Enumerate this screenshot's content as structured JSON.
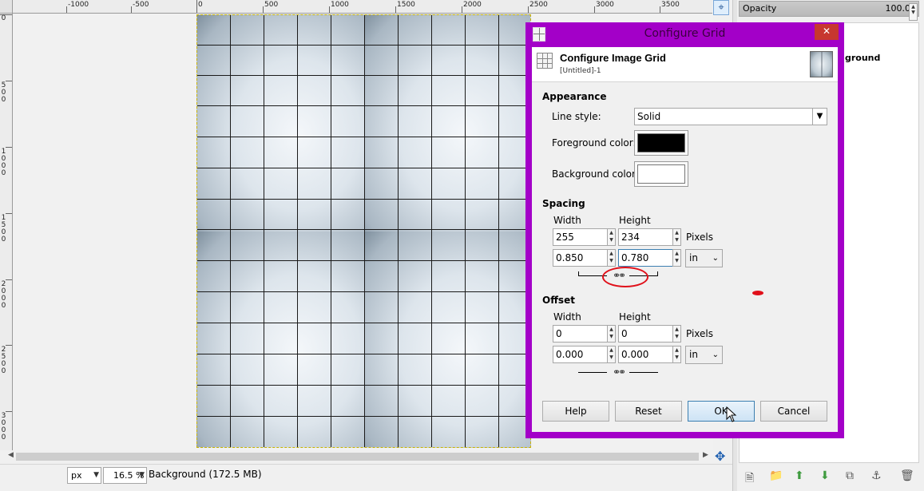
{
  "ruler_top": {
    "labels": [
      "-1000",
      "-500",
      "0",
      "500",
      "1000",
      "1500",
      "2000",
      "2500",
      "3000",
      "3500"
    ]
  },
  "ruler_left": {
    "labels": [
      "0",
      "5\n0\n0",
      "1\n0\n0\n0",
      "1\n5\n0\n0",
      "2\n0\n0\n0",
      "2\n5\n0\n0",
      "3\n0\n0\n0"
    ]
  },
  "statusbar": {
    "unit": "px",
    "zoom": "16.5 %",
    "status_text": "Background (172.5 MB)"
  },
  "dock": {
    "opacity_label": "Opacity",
    "opacity_value": "100.0",
    "layer_name_partial": "ground"
  },
  "dialog": {
    "window_title": "Configure Grid",
    "heading": "Configure Image Grid",
    "subheading": "[Untitled]-1",
    "appearance": {
      "title": "Appearance",
      "line_style_label": "Line style:",
      "line_style_value": "Solid",
      "foreground_label": "Foreground color:",
      "foreground_color": "#000000",
      "background_label": "Background color:",
      "background_color": "#ffffff"
    },
    "spacing": {
      "title": "Spacing",
      "width_label": "Width",
      "height_label": "Height",
      "width_px": "255",
      "height_px": "234",
      "px_unit": "Pixels",
      "width_in": "0.850",
      "height_in": "0.780",
      "unit": "in"
    },
    "offset": {
      "title": "Offset",
      "width_label": "Width",
      "height_label": "Height",
      "width_px": "0",
      "height_px": "0",
      "px_unit": "Pixels",
      "width_in": "0.000",
      "height_in": "0.000",
      "unit": "in"
    },
    "buttons": {
      "help": "Help",
      "reset": "Reset",
      "ok": "OK",
      "cancel": "Cancel"
    }
  },
  "colors": {
    "dialog_frame": "#a300c8",
    "annotation_red": "#e0101a",
    "close_button": "#c7372f"
  }
}
